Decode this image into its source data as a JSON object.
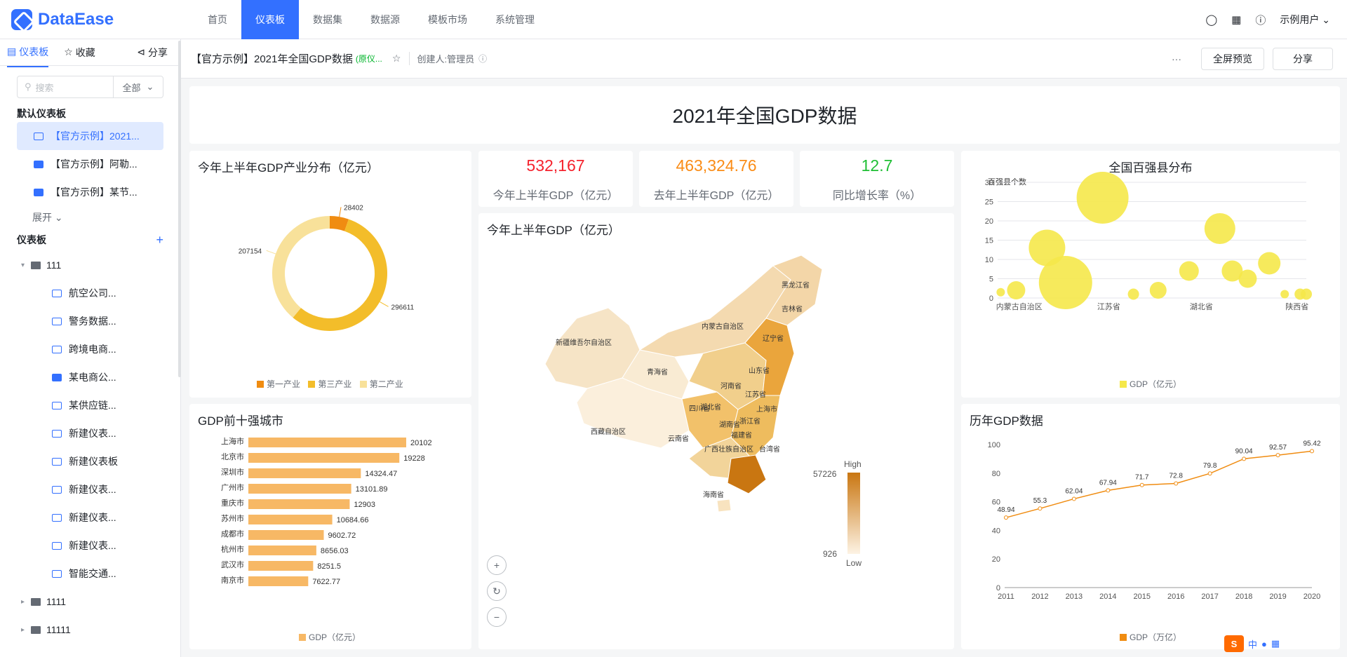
{
  "app": {
    "logo": "DataEase"
  },
  "nav": {
    "items": [
      "首页",
      "仪表板",
      "数据集",
      "数据源",
      "模板市场",
      "系统管理"
    ],
    "active": 1,
    "user": "示例用户"
  },
  "sidebar": {
    "tabs": [
      "仪表板",
      "收藏",
      "分享"
    ],
    "search": {
      "placeholder": "搜索",
      "filter": "全部"
    },
    "default_section": "默认仪表板",
    "default_items": [
      "【官方示例】2021...",
      "【官方示例】阿勒...",
      "【官方示例】某节..."
    ],
    "expand": "展开",
    "section": "仪表板",
    "folder_root": "111",
    "folder_items": [
      "航空公司...",
      "警务数据...",
      "跨境电商...",
      "某电商公...",
      "某供应链...",
      "新建仪表...",
      "新建仪表板",
      "新建仪表...",
      "新建仪表...",
      "新建仪表...",
      "智能交通..."
    ],
    "folders": [
      "1111",
      "11111"
    ]
  },
  "header": {
    "title": "【官方示例】2021年全国GDP数据",
    "tag": "(原仪...",
    "creator": "创建人:管理员",
    "more": "···",
    "fullscreen": "全屏预览",
    "share": "分享"
  },
  "dashboard": {
    "title": "2021年全国GDP数据",
    "kpis": [
      {
        "value": "532,167",
        "label": "今年上半年GDP（亿元）",
        "color": "#f5222d"
      },
      {
        "value": "463,324.76",
        "label": "去年上半年GDP（亿元）",
        "color": "#fa8c16"
      },
      {
        "value": "12.7",
        "label": "同比增长率（%）",
        "color": "#1fbf35"
      }
    ],
    "donut": {
      "title": "今年上半年GDP产业分布（亿元）",
      "labels": [
        "28402",
        "296611",
        "207154"
      ],
      "legend": [
        "第一产业",
        "第三产业",
        "第二产业"
      ]
    },
    "map": {
      "title": "今年上半年GDP（亿元）",
      "high": "High",
      "low": "Low",
      "max": "57226",
      "min": "926"
    },
    "bubble": {
      "title": "全国百强县分布",
      "ylabel": "百强县个数",
      "legend": "GDP（亿元）",
      "xlabels": [
        "内蒙古自治区",
        "江苏省",
        "湖北省",
        "陕西省"
      ]
    },
    "bars": {
      "title": "GDP前十强城市",
      "legend": "GDP（亿元）"
    },
    "line": {
      "title": "历年GDP数据",
      "legend": "GDP（万亿）"
    }
  },
  "chart_data": [
    {
      "type": "pie",
      "title": "今年上半年GDP产业分布（亿元）",
      "categories": [
        "第一产业",
        "第三产业",
        "第二产业"
      ],
      "values": [
        28402,
        296611,
        207154
      ]
    },
    {
      "type": "scatter",
      "title": "全国百强县分布",
      "ylabel": "百强县个数",
      "ylim": [
        0,
        30
      ],
      "x": [
        "内蒙古自治区",
        "江苏省",
        "湖北省",
        "陕西省"
      ]
    },
    {
      "type": "bar",
      "title": "GDP前十强城市",
      "categories": [
        "上海市",
        "北京市",
        "深圳市",
        "广州市",
        "重庆市",
        "苏州市",
        "成都市",
        "杭州市",
        "武汉市",
        "南京市"
      ],
      "values": [
        20102,
        19228,
        14324.47,
        13101.89,
        12903,
        10684.66,
        9602.72,
        8656.03,
        8251.5,
        7622.77
      ],
      "series": [
        {
          "name": "GDP（亿元）"
        }
      ]
    },
    {
      "type": "line",
      "title": "历年GDP数据",
      "categories": [
        "2011",
        "2012",
        "2013",
        "2014",
        "2015",
        "2016",
        "2017",
        "2018",
        "2019",
        "2020"
      ],
      "values": [
        48.94,
        55.3,
        62.04,
        67.94,
        71.7,
        72.8,
        79.8,
        90.04,
        92.57,
        95.42
      ],
      "ylim": [
        0,
        100
      ],
      "series": [
        {
          "name": "GDP（万亿）"
        }
      ]
    }
  ],
  "ime": {
    "lang": "中"
  }
}
